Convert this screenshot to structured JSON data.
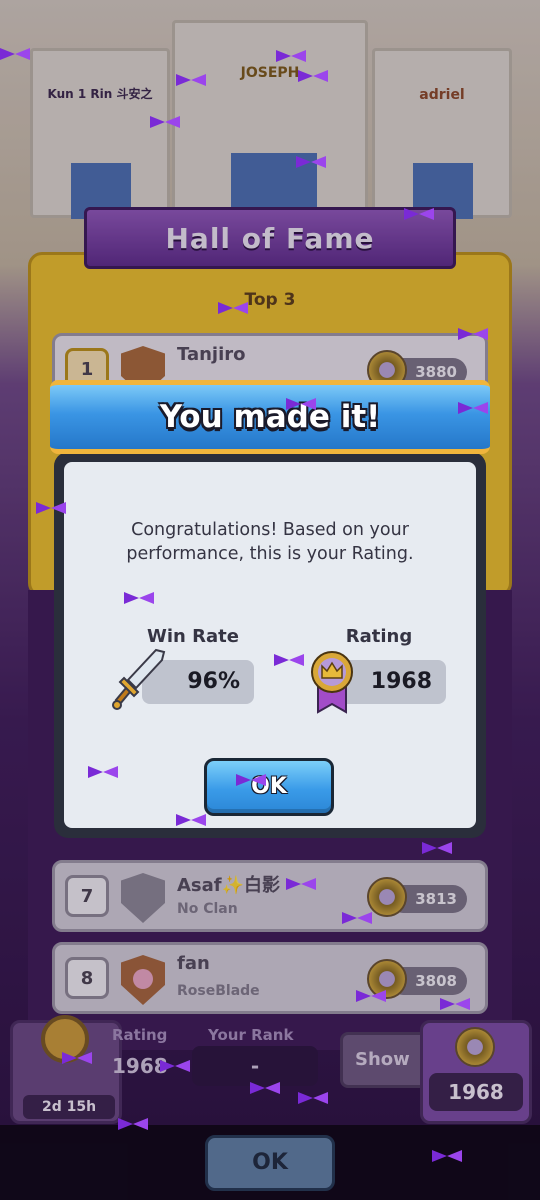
{
  "castles": {
    "left_name": "Kun 1 Rin 斗安之",
    "center_name": "JOSEPH",
    "right_name": "adriel"
  },
  "hall_of_fame": {
    "title": "Hall of Fame",
    "section": "Top 3"
  },
  "leaderboard": [
    {
      "rank": "1",
      "name": "Tanjiro",
      "clan": "",
      "rating": "3880"
    },
    {
      "rank": "7",
      "name": "Asaf✨白影",
      "clan": "No Clan",
      "rating": "3813"
    },
    {
      "rank": "8",
      "name": "fan",
      "clan": "RoseBlade",
      "rating": "3808"
    }
  ],
  "bottom_bar": {
    "timer": "2d 15h",
    "rating_label": "Rating",
    "rating_value": "1968",
    "your_rank_label": "Your Rank",
    "your_rank_value": "-",
    "show_button": "Show",
    "my_rating": "1968"
  },
  "footer": {
    "ok": "OK"
  },
  "modal": {
    "title": "You made it!",
    "message": "Congratulations! Based on your performance, this is your Rating.",
    "win_rate_label": "Win Rate",
    "win_rate_value": "96%",
    "rating_label": "Rating",
    "rating_value": "1968",
    "ok": "OK"
  },
  "colors": {
    "accent_blue": "#3a95e4",
    "gold": "#e7bd2e",
    "purple": "#3d1d57",
    "confetti": "#7a2ad6"
  },
  "icons": [
    "sword-icon",
    "trophy-crown-icon",
    "clock-icon",
    "clan-shield-icon",
    "confetti-ribbon"
  ]
}
